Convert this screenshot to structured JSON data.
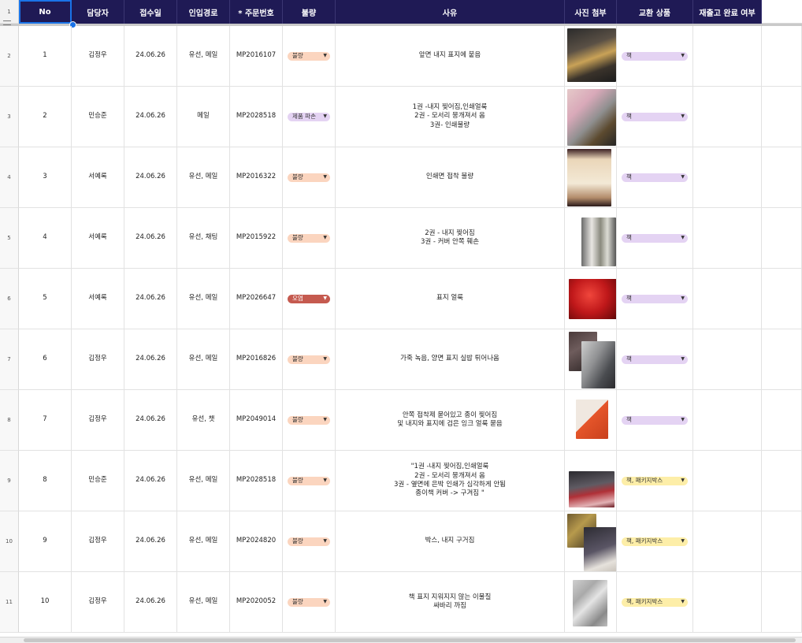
{
  "header": {
    "row_number": "1",
    "columns": [
      "No",
      "담당자",
      "접수일",
      "인입경로",
      "* 주문번호",
      "불량",
      "사유",
      "사진 첨부",
      "교환 상품",
      "재출고 완료 여부"
    ]
  },
  "colors": {
    "header_bg": "#1f1a55",
    "chip_defect_bg": "#fbd5bf",
    "chip_damage_bg": "#e4d3f3",
    "chip_stain_bg": "#c55a4f",
    "chip_book_bg": "#e4d3f3",
    "chip_package_bg": "#fdeea8"
  },
  "rows": [
    {
      "row_number": "2",
      "no": "1",
      "assignee": "김정우",
      "date": "24.06.26",
      "channel": "유선, 메일",
      "order_no": "MP2016107",
      "defect": "불량",
      "defect_kind": "defect",
      "reason": "앞면 내지 표지에 붙음",
      "photos": [
        "book-edge-photo"
      ],
      "exchange": "책",
      "exchange_kind": "book"
    },
    {
      "row_number": "3",
      "no": "2",
      "assignee": "민승준",
      "date": "24.06.26",
      "channel": "메일",
      "order_no": "MP2028518",
      "defect": "제품 파손",
      "defect_kind": "damage",
      "reason": "1권 -내지 찢어짐,인쇄얼룩\n2권 - 모서리 뭉개져서 옴\n3권- 인쇄불량",
      "photos": [
        "gloved-hand-book-photo"
      ],
      "exchange": "책",
      "exchange_kind": "book"
    },
    {
      "row_number": "4",
      "no": "3",
      "assignee": "서예록",
      "date": "24.06.26",
      "channel": "유선, 메일",
      "order_no": "MP2016322",
      "defect": "불량",
      "defect_kind": "defect",
      "reason": "인쇄면 접착 불량",
      "photos": [
        "open-book-photo"
      ],
      "exchange": "책",
      "exchange_kind": "book"
    },
    {
      "row_number": "5",
      "no": "4",
      "assignee": "서예록",
      "date": "24.06.26",
      "channel": "유선, 채팅",
      "order_no": "MP2015922",
      "defect": "불량",
      "defect_kind": "defect",
      "reason": "2권 - 내지 찢어짐\n3권 - 커버 안쪽 훼손",
      "photos": [
        "torn-page-photo"
      ],
      "exchange": "책",
      "exchange_kind": "book"
    },
    {
      "row_number": "6",
      "no": "5",
      "assignee": "서예록",
      "date": "24.06.26",
      "channel": "유선, 메일",
      "order_no": "MP2026647",
      "defect": "오염",
      "defect_kind": "stain",
      "reason": "표지 얼룩",
      "photos": [
        "red-cover-photo"
      ],
      "exchange": "책",
      "exchange_kind": "book"
    },
    {
      "row_number": "7",
      "no": "6",
      "assignee": "김정우",
      "date": "24.06.26",
      "channel": "유선, 메일",
      "order_no": "MP2016826",
      "defect": "불량",
      "defect_kind": "defect",
      "reason": "가죽 녹음, 양면 표지 실밥 튀어나옴",
      "photos": [
        "leather-cover-photo"
      ],
      "exchange": "책",
      "exchange_kind": "book"
    },
    {
      "row_number": "8",
      "no": "7",
      "assignee": "김정우",
      "date": "24.06.26",
      "channel": "유선, 챗",
      "order_no": "MP2049014",
      "defect": "불량",
      "defect_kind": "defect",
      "reason": "안쪽 접착제 묻어있고 종이 찢어짐\n및 내지와 표지에 검은 잉크 얼룩 묻음",
      "photos": [
        "orange-page-photo"
      ],
      "exchange": "책",
      "exchange_kind": "book"
    },
    {
      "row_number": "9",
      "no": "8",
      "assignee": "민승준",
      "date": "24.06.26",
      "channel": "유선, 메일",
      "order_no": "MP2028518",
      "defect": "불량",
      "defect_kind": "defect",
      "reason": "\"1권 -내지 찢어짐,인쇄얼룩\n2권 - 모서리 뭉개져서 옴\n3권 - 옆면에 은박 인쇄가 심각하게 안됨\n종이책 커버 -> 구겨짐 \"",
      "photos": [
        "red-edge-book-photo"
      ],
      "exchange": "책, 패키지박스",
      "exchange_kind": "package"
    },
    {
      "row_number": "10",
      "no": "9",
      "assignee": "김정우",
      "date": "24.06.26",
      "channel": "유선, 메일",
      "order_no": "MP2024820",
      "defect": "불량",
      "defect_kind": "defect",
      "reason": "박스, 내지 구거짐",
      "photos": [
        "box-photo"
      ],
      "exchange": "책, 패키지박스",
      "exchange_kind": "package"
    },
    {
      "row_number": "11",
      "no": "10",
      "assignee": "김정우",
      "date": "24.06.26",
      "channel": "유선, 메일",
      "order_no": "MP2020052",
      "defect": "불량",
      "defect_kind": "defect",
      "reason": "책 표지 지워지지 않는 이물질\n싸바리 까짐",
      "photos": [
        "silver-cover-photo"
      ],
      "exchange": "책, 패키지박스",
      "exchange_kind": "package"
    }
  ]
}
